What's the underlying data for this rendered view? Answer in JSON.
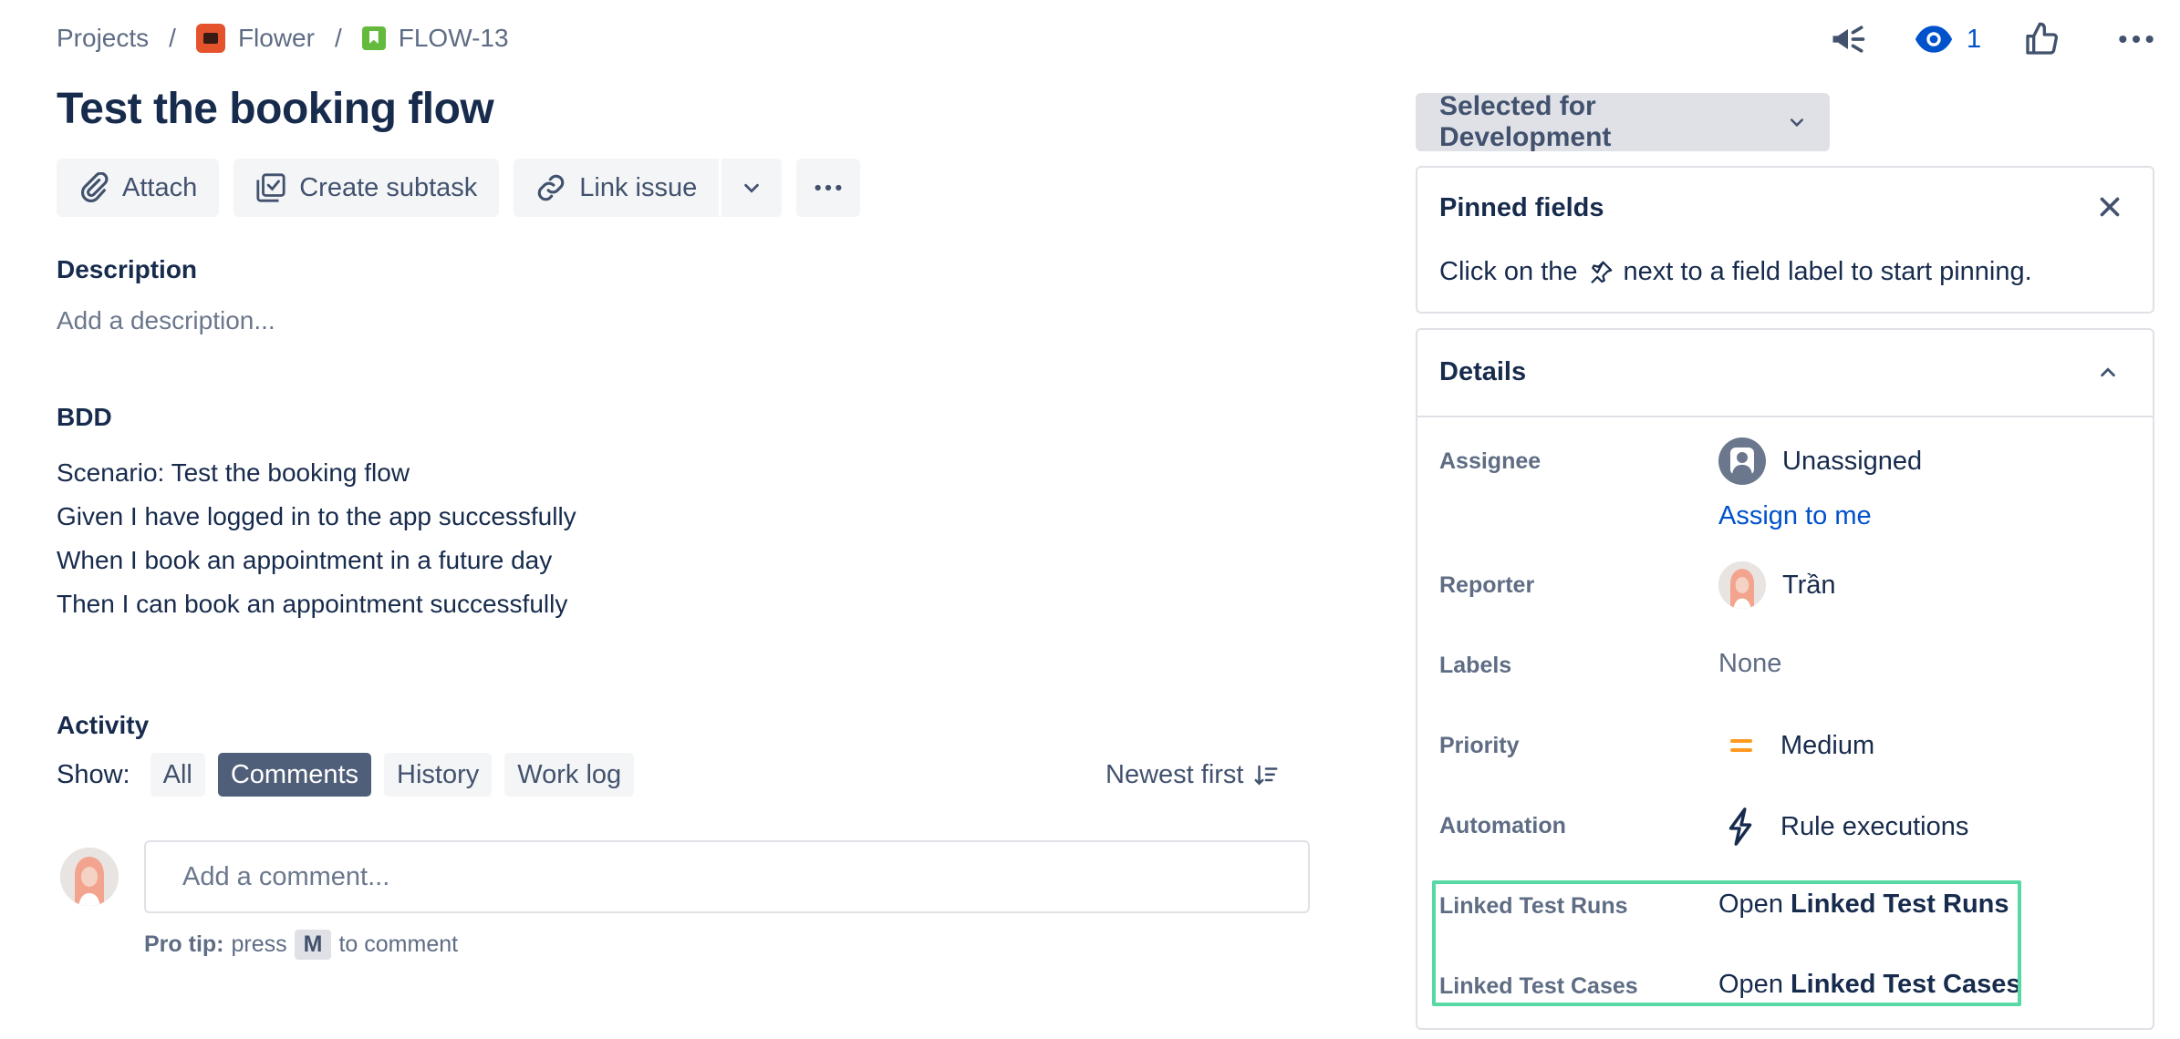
{
  "breadcrumb": {
    "projects": "Projects",
    "separator": "/",
    "project": "Flower",
    "issue_key": "FLOW-13"
  },
  "header_actions": {
    "watchers_count": "1"
  },
  "issue": {
    "title": "Test the booking flow"
  },
  "toolbar": {
    "attach": "Attach",
    "create_subtask": "Create subtask",
    "link_issue": "Link issue"
  },
  "description": {
    "label": "Description",
    "placeholder": "Add a description..."
  },
  "bdd": {
    "label": "BDD",
    "lines": [
      "Scenario: Test the booking flow",
      "Given I have logged in to the app successfully",
      "When I book an appointment in a future day",
      "Then I can book an appointment successfully"
    ]
  },
  "activity": {
    "label": "Activity",
    "show_label": "Show:",
    "filters": [
      "All",
      "Comments",
      "History",
      "Work log"
    ],
    "active_filter": "Comments",
    "sort_label": "Newest first",
    "comment_placeholder": "Add a comment...",
    "protip_bold": "Pro tip:",
    "protip_press": "press",
    "protip_key": "M",
    "protip_rest": "to comment"
  },
  "status": {
    "label": "Selected for Development"
  },
  "pinned": {
    "title": "Pinned fields",
    "text_before": "Click on the",
    "text_after": "next to a field label to start pinning."
  },
  "details": {
    "title": "Details",
    "assignee_label": "Assignee",
    "assignee_value": "Unassigned",
    "assign_to_me": "Assign to me",
    "reporter_label": "Reporter",
    "reporter_value": "Trần",
    "labels_label": "Labels",
    "labels_value": "None",
    "priority_label": "Priority",
    "priority_value": "Medium",
    "automation_label": "Automation",
    "automation_value": "Rule executions",
    "linked_runs_label": "Linked Test Runs",
    "linked_runs_open": "Open",
    "linked_runs_name": "Linked Test Runs",
    "linked_cases_label": "Linked Test Cases",
    "linked_cases_open": "Open",
    "linked_cases_name": "Linked Test Cases"
  },
  "colors": {
    "text_primary": "#172b4d",
    "text_subtle": "#5e6c84",
    "link": "#0052cc",
    "active_pill": "#505f79",
    "highlight_border": "#57d9a3",
    "priority_medium": "#ff991f",
    "project_icon": "#e5532d",
    "story_icon": "#63ba3c"
  }
}
